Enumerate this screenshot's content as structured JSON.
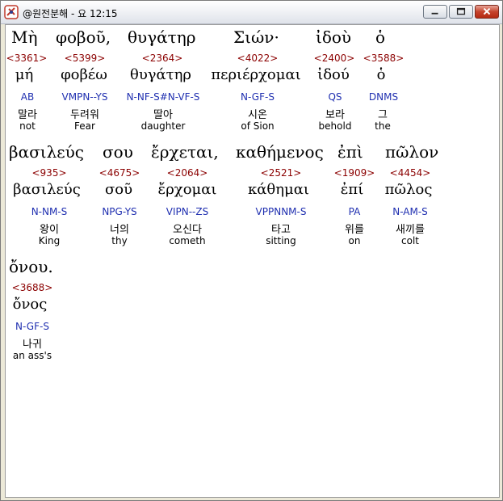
{
  "window": {
    "title": "@원전분해 - 요 12:15"
  },
  "words": [
    {
      "greek": "Μὴ",
      "strong": "<3361>",
      "lemma": "μή",
      "parse": "AB",
      "korean": "말라",
      "english": "not"
    },
    {
      "greek": "φοβοῦ,",
      "strong": "<5399>",
      "lemma": "φοβέω",
      "parse": "VMPN--YS",
      "korean": "두려워",
      "english": "Fear"
    },
    {
      "greek": "θυγάτηρ",
      "strong": "<2364>",
      "lemma": "θυγάτηρ",
      "parse": "N-NF-S#N-VF-S",
      "korean": "딸아",
      "english": "daughter"
    },
    {
      "greek": "Σιών·",
      "strong": "<4022>",
      "lemma": "περιέρχομαι",
      "parse": "N-GF-S",
      "korean": "시온",
      "english": "of Sion"
    },
    {
      "greek": "ἰδοὺ",
      "strong": "<2400>",
      "lemma": "ἰδού",
      "parse": "QS",
      "korean": "보라",
      "english": "behold"
    },
    {
      "greek": "ὁ",
      "strong": "<3588>",
      "lemma": "ὁ",
      "parse": "DNMS",
      "korean": "그",
      "english": "the"
    },
    {
      "greek": "βασιλεύς",
      "strong": "<935>",
      "lemma": "βασιλεύς",
      "parse": "N-NM-S",
      "korean": "왕이",
      "english": "King"
    },
    {
      "greek": "σου",
      "strong": "<4675>",
      "lemma": "σοῦ",
      "parse": "NPG-YS",
      "korean": "너의",
      "english": "thy"
    },
    {
      "greek": "ἔρχεται,",
      "strong": "<2064>",
      "lemma": "ἔρχομαι",
      "parse": "VIPN--ZS",
      "korean": "오신다",
      "english": "cometh"
    },
    {
      "greek": "καθήμενος",
      "strong": "<2521>",
      "lemma": "κάθημαι",
      "parse": "VPPNNM-S",
      "korean": "타고",
      "english": "sitting"
    },
    {
      "greek": "ἐπὶ",
      "strong": "<1909>",
      "lemma": "ἐπί",
      "parse": "PA",
      "korean": "위를",
      "english": "on"
    },
    {
      "greek": "πῶλον",
      "strong": "<4454>",
      "lemma": "πῶλος",
      "parse": "N-AM-S",
      "korean": "새끼를",
      "english": "colt"
    },
    {
      "greek": "ὄνου.",
      "strong": "<3688>",
      "lemma": "ὄνος",
      "parse": "N-GF-S",
      "korean": "나귀",
      "english": "an ass's"
    }
  ]
}
